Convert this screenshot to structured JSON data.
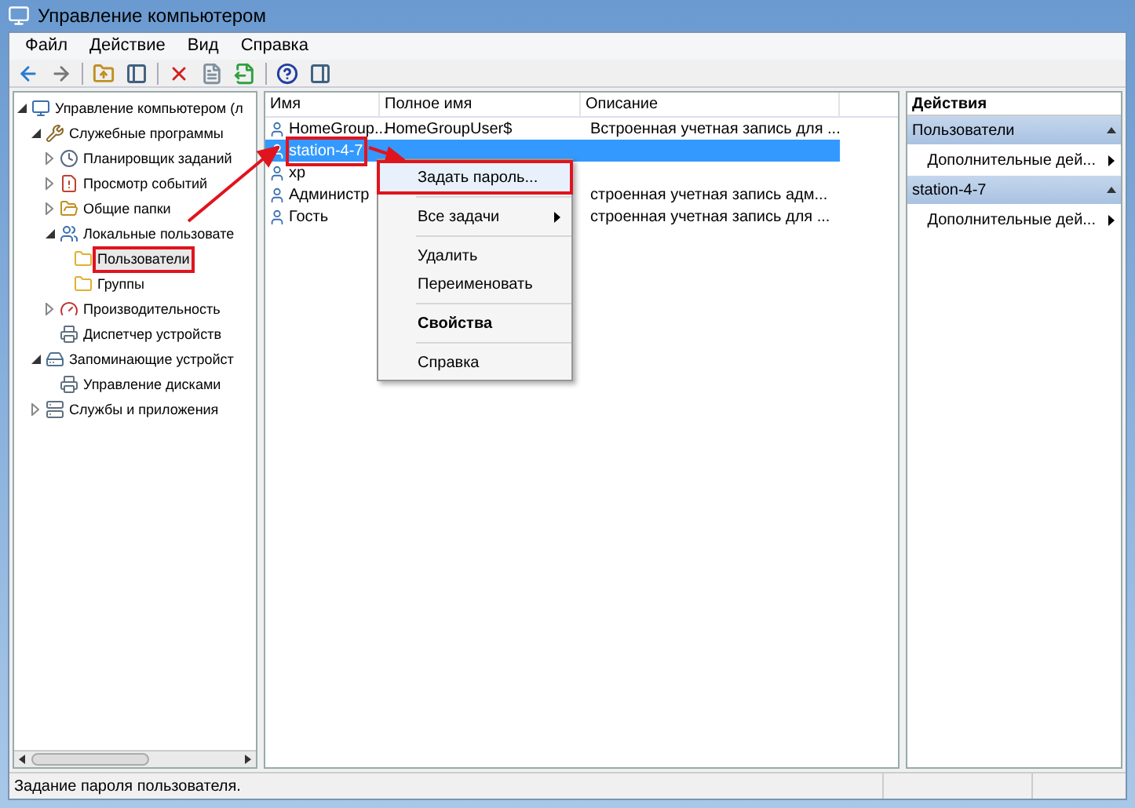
{
  "window": {
    "title": "Управление компьютером"
  },
  "menu": [
    "Файл",
    "Действие",
    "Вид",
    "Справка"
  ],
  "tree": [
    {
      "label": "Управление компьютером (л",
      "expanded": true,
      "selected": false,
      "marked": false,
      "children": [
        {
          "label": "Служебные программы",
          "expanded": true,
          "selected": false,
          "marked": false,
          "children": [
            {
              "label": "Планировщик заданий",
              "expanded": false,
              "selected": false,
              "marked": false
            },
            {
              "label": "Просмотр событий",
              "expanded": false,
              "selected": false,
              "marked": false
            },
            {
              "label": "Общие папки",
              "expanded": false,
              "selected": false,
              "marked": false
            },
            {
              "label": "Локальные пользовате",
              "expanded": true,
              "selected": false,
              "marked": false,
              "children": [
                {
                  "label": "Пользователи",
                  "selected": true,
                  "marked": true
                },
                {
                  "label": "Группы",
                  "selected": false,
                  "marked": false
                }
              ]
            },
            {
              "label": "Производительность",
              "expanded": false,
              "selected": false,
              "marked": false
            },
            {
              "label": "Диспетчер устройств",
              "selected": false,
              "marked": false
            }
          ]
        },
        {
          "label": "Запоминающие устройст",
          "expanded": true,
          "selected": false,
          "marked": false,
          "children": [
            {
              "label": "Управление дисками",
              "selected": false,
              "marked": false
            }
          ]
        },
        {
          "label": "Службы и приложения",
          "expanded": false,
          "selected": false,
          "marked": false
        }
      ]
    }
  ],
  "table": {
    "columns": [
      "Имя",
      "Полное имя",
      "Описание"
    ],
    "rows": [
      {
        "name": "HomeGroup...",
        "full_name": "HomeGroupUser$",
        "description": "Встроенная учетная запись для ...",
        "selected": false,
        "marked": false
      },
      {
        "name": "station-4-7",
        "selected": true,
        "marked": true
      },
      {
        "name": "xp",
        "selected": false,
        "marked": false
      },
      {
        "name": "Администр",
        "description": "строенная учетная запись адм...",
        "selected": false,
        "marked": false
      },
      {
        "name": "Гость",
        "description": "строенная учетная запись для ...",
        "selected": false,
        "marked": false
      }
    ]
  },
  "context_menu": [
    {
      "kind": "item",
      "label": "Задать пароль...",
      "bold": false,
      "submenu": false,
      "marked": true
    },
    {
      "kind": "separator"
    },
    {
      "kind": "item",
      "label": "Все задачи",
      "bold": false,
      "submenu": true,
      "marked": false
    },
    {
      "kind": "separator"
    },
    {
      "kind": "item",
      "label": "Удалить",
      "bold": false,
      "submenu": false,
      "marked": false
    },
    {
      "kind": "item",
      "label": "Переименовать",
      "bold": false,
      "submenu": false,
      "marked": false
    },
    {
      "kind": "separator"
    },
    {
      "kind": "item",
      "label": "Свойства",
      "bold": true,
      "submenu": false,
      "marked": false
    },
    {
      "kind": "separator"
    },
    {
      "kind": "item",
      "label": "Справка",
      "bold": false,
      "submenu": false,
      "marked": false
    }
  ],
  "actions": {
    "title": "Действия",
    "sections": [
      {
        "title": "Пользователи",
        "expanded": true,
        "items": [
          "Дополнительные дей..."
        ]
      },
      {
        "title": "station-4-7",
        "expanded": true,
        "items": [
          "Дополнительные дей..."
        ]
      }
    ]
  },
  "status_bar": "Задание пароля пользователя."
}
